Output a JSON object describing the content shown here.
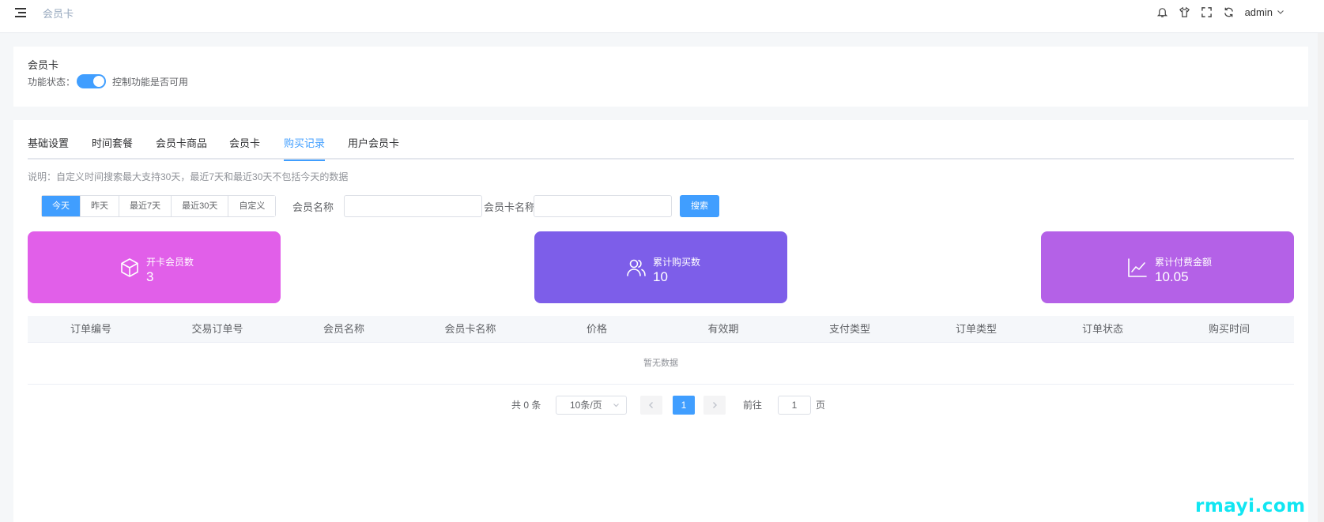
{
  "header": {
    "breadcrumb": "会员卡",
    "user": "admin",
    "icons": [
      "bell-icon",
      "tshirt-icon",
      "fullscreen-icon",
      "refresh-icon"
    ]
  },
  "feature_card": {
    "title": "会员卡",
    "status_label": "功能状态：",
    "switch_on": true,
    "switch_hint": "控制功能是否可用"
  },
  "tabs": [
    {
      "label": "基础设置",
      "active": false
    },
    {
      "label": "时间套餐",
      "active": false
    },
    {
      "label": "会员卡商品",
      "active": false
    },
    {
      "label": "会员卡",
      "active": false
    },
    {
      "label": "购买记录",
      "active": true
    },
    {
      "label": "用户会员卡",
      "active": false
    }
  ],
  "note": "说明：自定义时间搜索最大支持30天，最近7天和最近30天不包括今天的数据",
  "filters": {
    "ranges": [
      "今天",
      "昨天",
      "最近7天",
      "最近30天",
      "自定义"
    ],
    "active_range": "今天",
    "member_name_label": "会员名称",
    "member_name_value": "",
    "card_name_label": "会员卡名称",
    "card_name_value": "",
    "search_label": "搜索"
  },
  "stats": [
    {
      "label": "开卡会员数",
      "value": "3",
      "color": "#e15fe9",
      "icon": "box-icon"
    },
    {
      "label": "累计购买数",
      "value": "10",
      "color": "#7d5ee9",
      "icon": "users-icon"
    },
    {
      "label": "累计付费金额",
      "value": "10.05",
      "color": "#b461e7",
      "icon": "chart-line-icon"
    }
  ],
  "table": {
    "columns": [
      "订单编号",
      "交易订单号",
      "会员名称",
      "会员卡名称",
      "价格",
      "有效期",
      "支付类型",
      "订单类型",
      "订单状态",
      "购买时间"
    ],
    "empty_text": "暂无数据"
  },
  "pagination": {
    "total_text": "共 0 条",
    "page_size": "10条/页",
    "current_page": "1",
    "goto_label": "前往",
    "goto_value": "1",
    "page_suffix": "页"
  },
  "watermark": "rmayi.com",
  "colors": {
    "primary": "#409eff"
  }
}
